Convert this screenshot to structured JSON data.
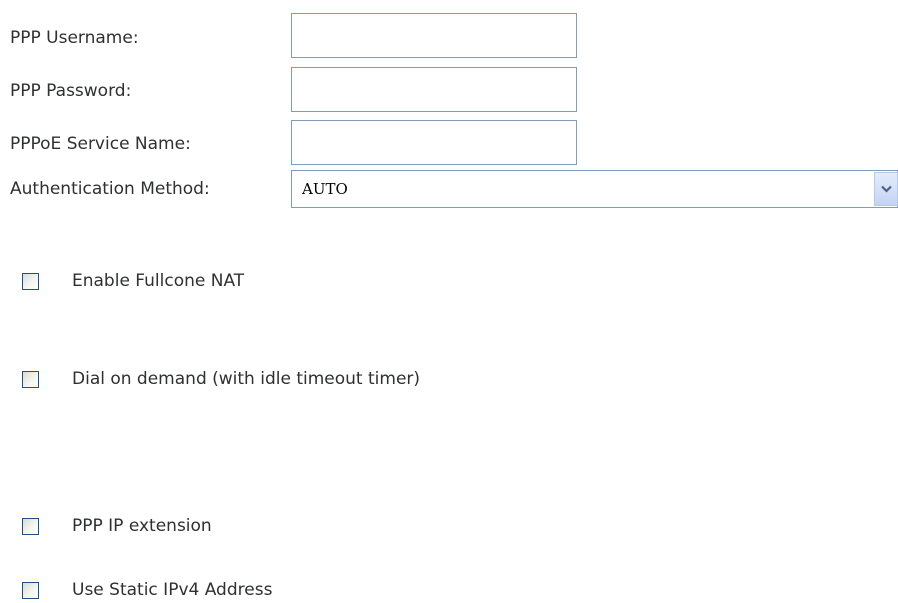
{
  "form": {
    "username": {
      "label": "PPP Username:",
      "value": "",
      "placeholder": ""
    },
    "password": {
      "label": "PPP Password:",
      "value": "",
      "placeholder": ""
    },
    "service_name": {
      "label": "PPPoE Service Name:",
      "value": "",
      "placeholder": ""
    },
    "auth_method": {
      "label": "Authentication Method:",
      "selected": "AUTO"
    }
  },
  "options": {
    "fullcone_nat": {
      "label": "Enable Fullcone NAT",
      "checked": false
    },
    "dial_on_demand": {
      "label": "Dial on demand (with idle timeout timer)",
      "checked": false
    },
    "ip_extension": {
      "label": "PPP IP extension",
      "checked": false
    },
    "static_ipv4": {
      "label": "Use Static IPv4 Address",
      "checked": false
    }
  },
  "icons": {
    "select_arrow": "chevron-down-icon"
  },
  "colors": {
    "text": "#2f3030",
    "input_border": "#7f9db9",
    "checkbox_border": "#1c5180",
    "select_arrow_bg": "#c3d4f3"
  }
}
